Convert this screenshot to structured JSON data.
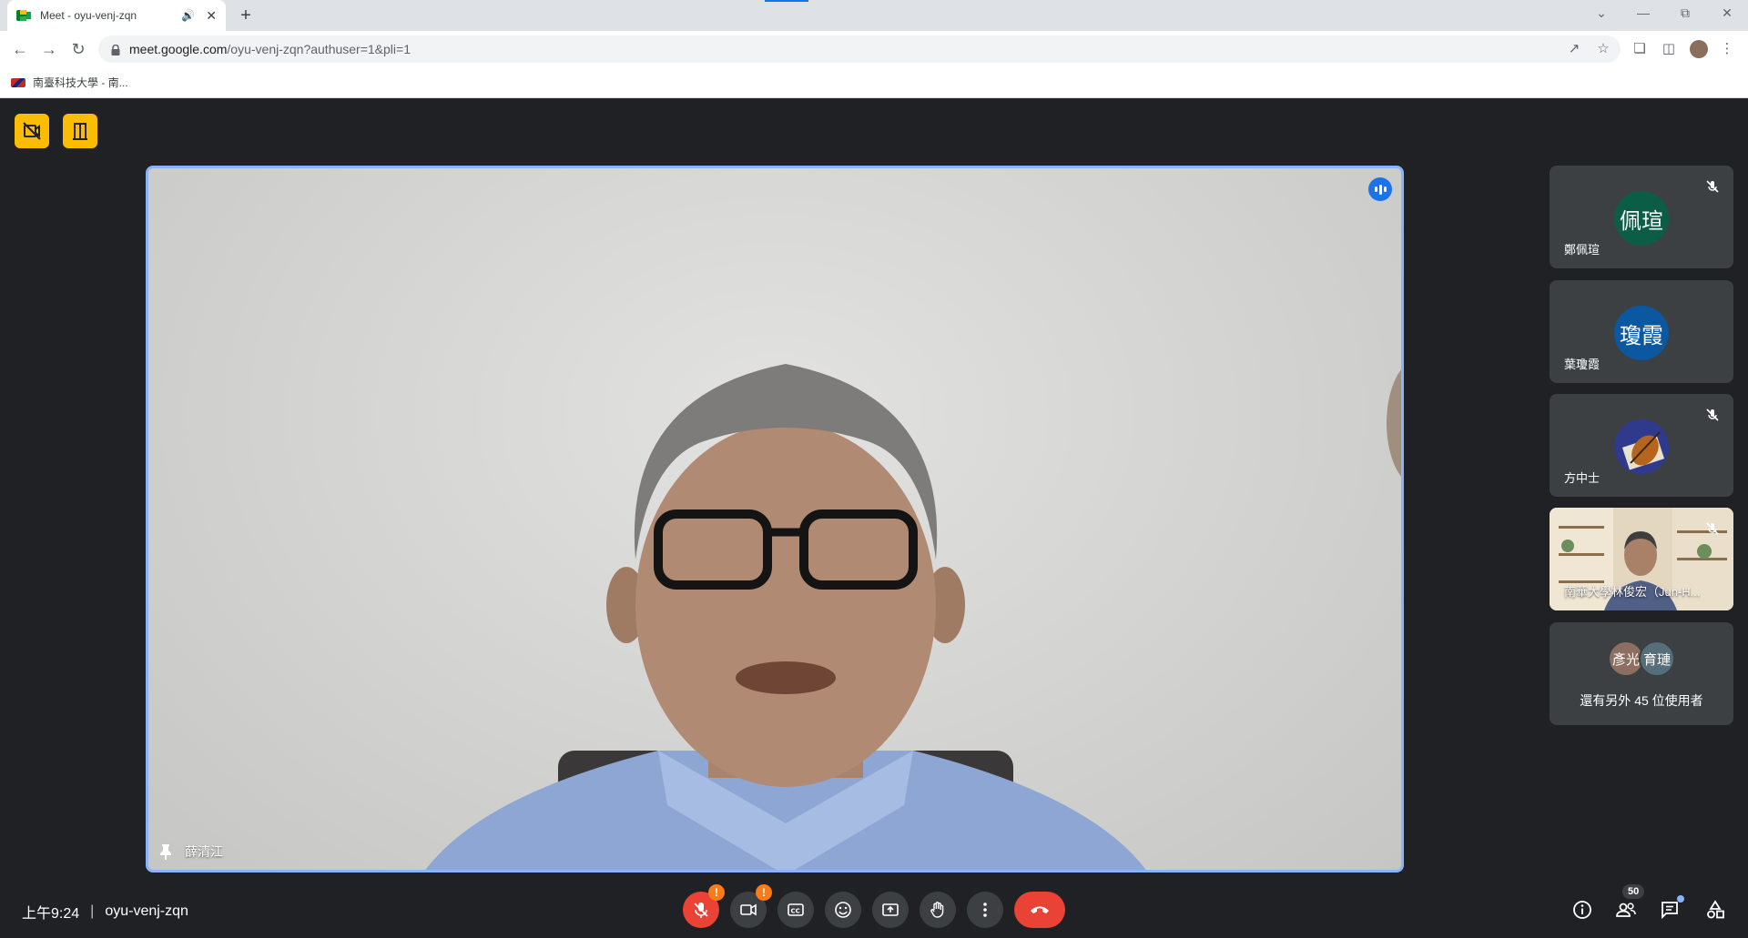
{
  "browser": {
    "tab": {
      "title": "Meet - oyu-venj-zqn"
    },
    "new_tab_label": "+",
    "url": {
      "host": "meet.google.com",
      "path": "/oyu-venj-zqn?authuser=1&pli=1"
    },
    "bookmark": {
      "label": "南臺科技大學 - 南..."
    }
  },
  "meet": {
    "main_speaker": {
      "name": "薛清江"
    },
    "participants": [
      {
        "initials": "佩瑄",
        "name": "鄭佩瑄",
        "avatar_color": "#0b5d46",
        "muted": true
      },
      {
        "initials": "瓊霞",
        "name": "葉瓊霞",
        "avatar_color": "#0b57a0",
        "muted": false
      },
      {
        "initials": "",
        "name": "方中士",
        "avatar_color": "#2f3a8c",
        "muted": true
      },
      {
        "initials": "",
        "name": "南華大學林俊宏（Jun-H...",
        "avatar_color": "#d8c7a8",
        "muted": true
      }
    ],
    "others": {
      "avatars": [
        {
          "initials": "彥光",
          "color": "#8d6e63"
        },
        {
          "initials": "育璉",
          "color": "#546e7a"
        }
      ],
      "text": "還有另外 45 位使用者"
    },
    "meeting_time": "上午9:24",
    "meeting_separator": "|",
    "meeting_code": "oyu-venj-zqn",
    "participant_count": "50",
    "warning_mark": "!"
  },
  "icons": {
    "close": "close-icon",
    "audio": "speaker-icon",
    "back": "arrow-left-icon",
    "forward": "arrow-right-icon",
    "reload": "reload-icon"
  }
}
